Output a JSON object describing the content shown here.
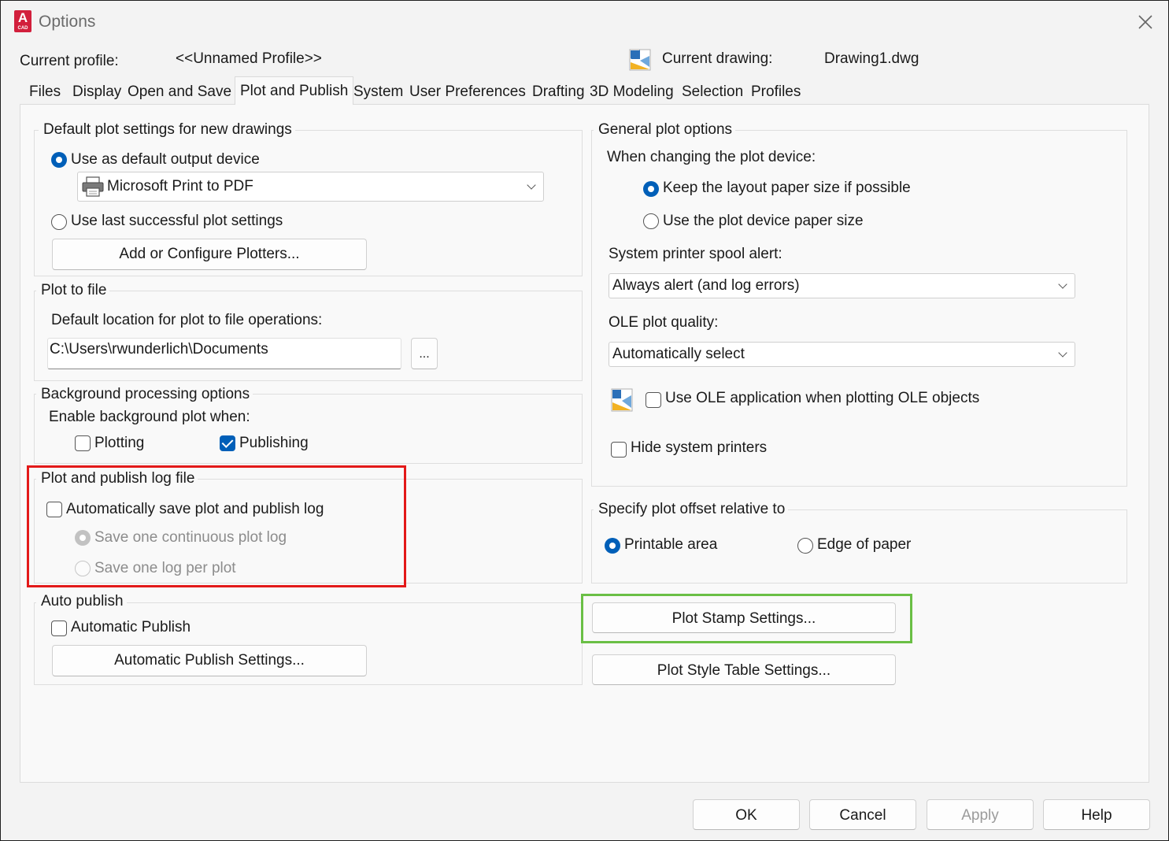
{
  "window": {
    "title": "Options",
    "close_icon": "close-icon"
  },
  "header": {
    "profile_label": "Current profile:",
    "profile_value": "<<Unnamed Profile>>",
    "drawing_label": "Current drawing:",
    "drawing_value": "Drawing1.dwg"
  },
  "app_icon": {
    "letter": "A",
    "sub": "CAD",
    "color": "#d21f3c"
  },
  "tabs": [
    {
      "label": "Files"
    },
    {
      "label": "Display"
    },
    {
      "label": "Open and Save"
    },
    {
      "label": "Plot and Publish",
      "active": true
    },
    {
      "label": "System"
    },
    {
      "label": "User Preferences"
    },
    {
      "label": "Drafting"
    },
    {
      "label": "3D Modeling"
    },
    {
      "label": "Selection"
    },
    {
      "label": "Profiles"
    }
  ],
  "default_plot": {
    "legend": "Default plot settings for new drawings",
    "use_default_device": {
      "pre": "Use as default output device",
      "selected": true
    },
    "device_select": "Microsoft Print to PDF",
    "use_last_settings": "Use last successful plot settings",
    "configure_button": "Add or Configure Plotters..."
  },
  "plot_to_file": {
    "legend": "Plot to file",
    "location_label": "Default location for plot to file operations:",
    "location_value": "C:\\Users\\rwunderlich\\Documents",
    "browse_button": "..."
  },
  "background": {
    "legend": "Background processing options",
    "enable_label": "Enable background plot when:",
    "plotting": {
      "label": "Plotting",
      "checked": false
    },
    "publishing": {
      "label": "Publishing",
      "checked": true
    }
  },
  "log_file": {
    "legend": "Plot and publish log file",
    "auto_save": {
      "label": "Automatically save plot and publish log",
      "checked": false
    },
    "continuous": "Save one continuous plot log",
    "per_plot": "Save one log per plot"
  },
  "auto_publish": {
    "legend": "Auto publish",
    "automatic": {
      "label": "Automatic Publish",
      "checked": false
    },
    "settings_button": "Automatic Publish Settings..."
  },
  "general": {
    "legend": "General plot options",
    "changing_label": "When changing the plot device:",
    "keep_layout": {
      "label": "Keep the layout paper size if possible",
      "selected": true
    },
    "use_device": "Use the plot device paper size",
    "spool_label": "System printer spool alert:",
    "spool_value": "Always alert (and log errors)",
    "ole_label": "OLE plot quality:",
    "ole_value": "Automatically select",
    "use_ole": {
      "label": "Use OLE application when plotting OLE objects",
      "checked": false
    },
    "hide_printers": {
      "label": "Hide system printers",
      "checked": false
    }
  },
  "offset": {
    "legend": "Specify plot offset relative to",
    "printable": {
      "label": "Printable area",
      "selected": true
    },
    "edge": "Edge of paper"
  },
  "buttons": {
    "plot_stamp": "Plot Stamp Settings...",
    "plot_style": "Plot Style Table Settings...",
    "ok": "OK",
    "cancel": "Cancel",
    "apply": "Apply",
    "help": "Help"
  },
  "highlights": {
    "red": "#e31919",
    "green": "#6abf45"
  },
  "accent_color": "#005fb8"
}
